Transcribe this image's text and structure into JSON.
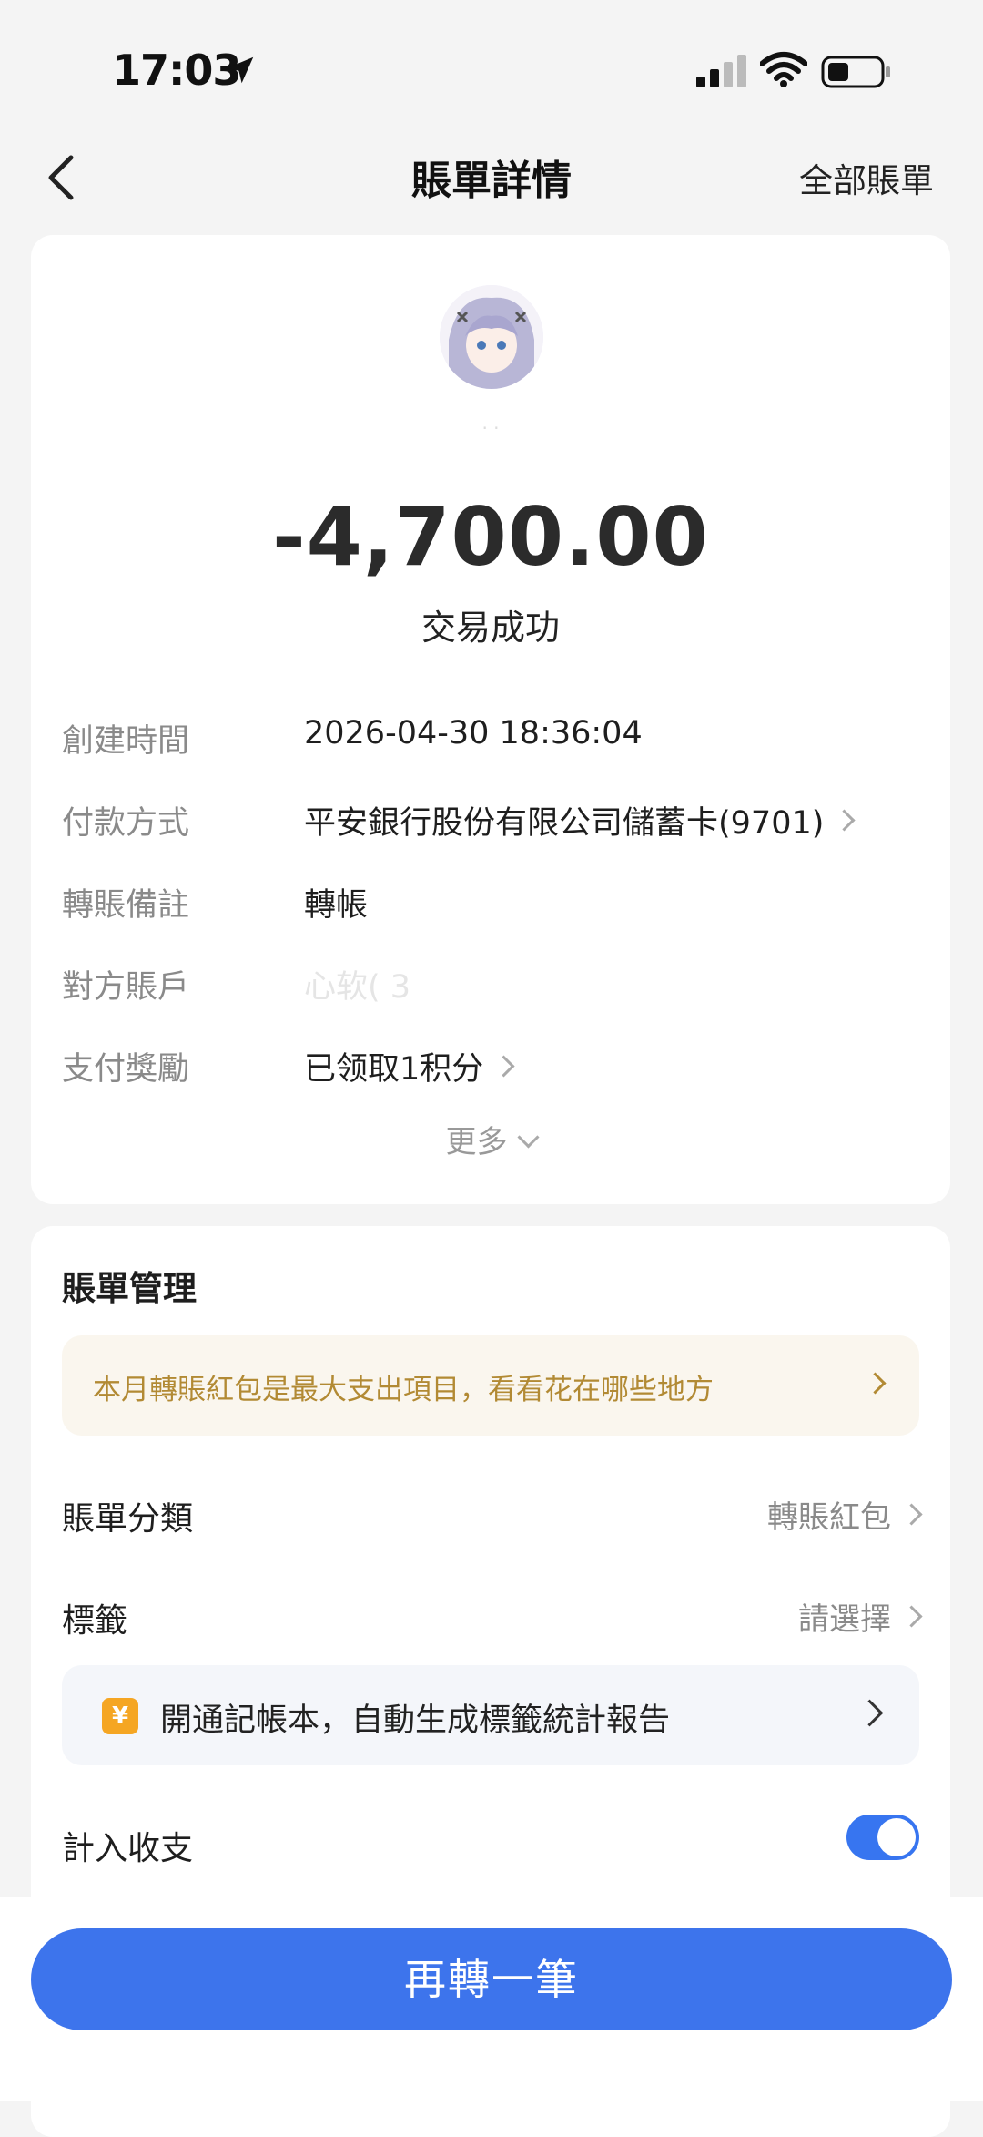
{
  "status_bar": {
    "time": "17:03"
  },
  "nav": {
    "title": "賬單詳情",
    "right_link": "全部賬單"
  },
  "transaction": {
    "payee_name": "· ·",
    "amount": "-4,700.00",
    "status": "交易成功",
    "details": [
      {
        "label": "創建時間",
        "value": "2026-04-30 18:36:04",
        "has_chevron": false
      },
      {
        "label": "付款方式",
        "value": "平安銀行股份有限公司儲蓄卡(9701)",
        "has_chevron": true
      },
      {
        "label": "轉賬備註",
        "value": "轉帳",
        "has_chevron": false
      },
      {
        "label": "對方賬戶",
        "value": "心软(                    3",
        "has_chevron": false
      },
      {
        "label": "支付獎勵",
        "value": "已领取1积分",
        "has_chevron": true
      }
    ],
    "more_label": "更多"
  },
  "management": {
    "title": "賬單管理",
    "banner_text": "本月轉賬紅包是最大支出項目，看看花在哪些地方",
    "category_label": "賬單分類",
    "category_value": "轉賬紅包",
    "tag_label": "標籤",
    "tag_value": "請選擇",
    "promo_icon": "¥",
    "promo_text": "開通記帳本，自動生成標籤統計報告",
    "include_label": "計入收支",
    "include_enabled": true
  },
  "cta": {
    "label": "再轉一筆"
  },
  "colors": {
    "accent": "#3D74EC",
    "banner_text": "#B28A34",
    "toggle": "#3775F0"
  }
}
